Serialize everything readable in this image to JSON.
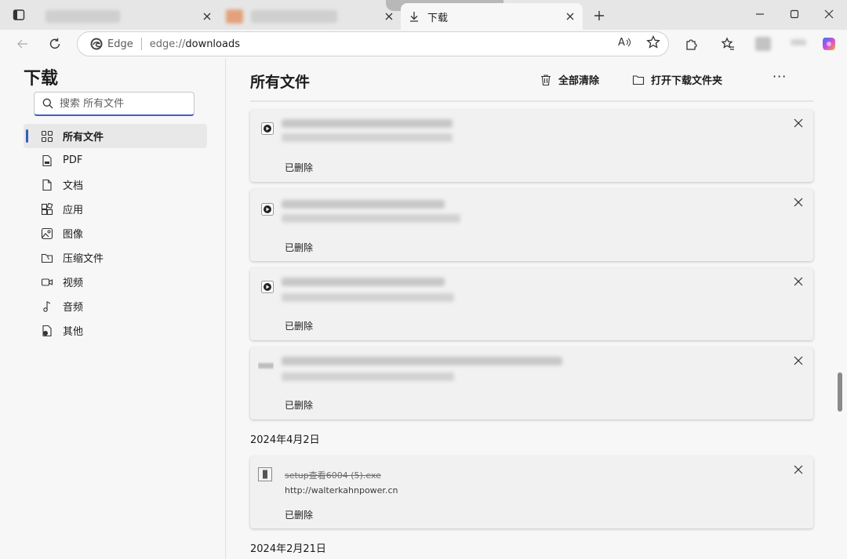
{
  "tabs": {
    "active_label": "下载",
    "new_tab_symbol": "+"
  },
  "toolbar": {
    "site_name": "Edge",
    "url_scheme": "edge://",
    "url_path": "downloads",
    "read_aloud_label": "A"
  },
  "sidebar": {
    "title": "下载",
    "search_placeholder": "搜索 所有文件",
    "items": [
      {
        "label": "所有文件",
        "icon": "grid-icon"
      },
      {
        "label": "PDF",
        "icon": "pdf-icon"
      },
      {
        "label": "文档",
        "icon": "document-icon"
      },
      {
        "label": "应用",
        "icon": "apps-icon"
      },
      {
        "label": "图像",
        "icon": "image-icon"
      },
      {
        "label": "压缩文件",
        "icon": "archive-icon"
      },
      {
        "label": "视频",
        "icon": "video-icon"
      },
      {
        "label": "音频",
        "icon": "audio-icon"
      },
      {
        "label": "其他",
        "icon": "other-file-icon"
      }
    ]
  },
  "main": {
    "title": "所有文件",
    "clear_all_label": "全部清除",
    "open_folder_label": "打开下载文件夹",
    "more_label": "···",
    "downloads": [
      {
        "status": "已删除"
      },
      {
        "status": "已删除"
      },
      {
        "status": "已删除"
      },
      {
        "status": "已删除"
      }
    ],
    "groups": [
      {
        "date": "2024年4月2日",
        "items": [
          {
            "name": "setup查看6004 (5).exe",
            "url": "http://walterkahnpower.cn",
            "status": "已删除"
          }
        ]
      },
      {
        "date": "2024年2月21日",
        "items": []
      }
    ]
  },
  "colors": {
    "accent": "#2f5fb8",
    "copilot": "#d14be0"
  }
}
